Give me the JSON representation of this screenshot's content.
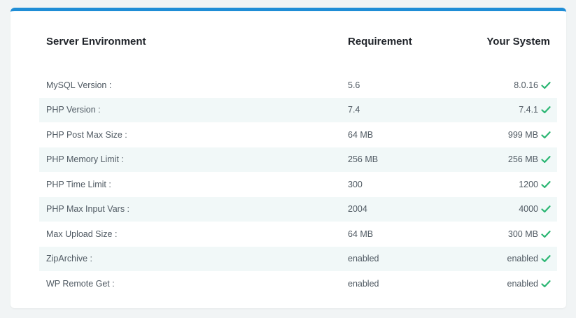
{
  "header": {
    "col_env": "Server Environment",
    "col_req": "Requirement",
    "col_sys": "Your System"
  },
  "rows": [
    {
      "label": "MySQL Version :",
      "requirement": "5.6",
      "system": "8.0.16",
      "status": "check-icon"
    },
    {
      "label": "PHP Version :",
      "requirement": "7.4",
      "system": "7.4.1",
      "status": "check-icon"
    },
    {
      "label": "PHP Post Max Size :",
      "requirement": "64 MB",
      "system": "999 MB",
      "status": "check-icon"
    },
    {
      "label": "PHP Memory Limit :",
      "requirement": "256 MB",
      "system": "256 MB",
      "status": "check-icon"
    },
    {
      "label": "PHP Time Limit :",
      "requirement": "300",
      "system": "1200",
      "status": "check-icon"
    },
    {
      "label": "PHP Max Input Vars :",
      "requirement": "2004",
      "system": "4000",
      "status": "check-icon"
    },
    {
      "label": "Max Upload Size :",
      "requirement": "64 MB",
      "system": "300 MB",
      "status": "check-icon"
    },
    {
      "label": "ZipArchive :",
      "requirement": "enabled",
      "system": "enabled",
      "status": "check-icon"
    },
    {
      "label": "WP Remote Get :",
      "requirement": "enabled",
      "system": "enabled",
      "status": "check-icon"
    }
  ],
  "colors": {
    "accent": "#1f8dd6",
    "check": "#2bb673"
  }
}
